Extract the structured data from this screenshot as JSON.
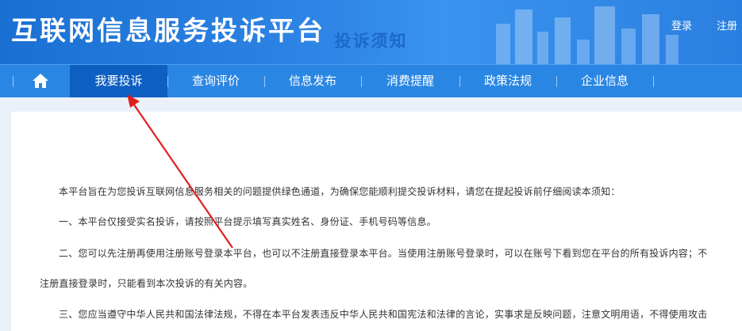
{
  "header": {
    "site_title": "互联网信息服务投诉平台",
    "login_label": "登录",
    "register_label": "注册"
  },
  "nav": {
    "home_icon": "home-icon",
    "items": [
      {
        "label": "我要投诉",
        "active": true
      },
      {
        "label": "查询评价",
        "active": false
      },
      {
        "label": "信息发布",
        "active": false
      },
      {
        "label": "消费提醒",
        "active": false
      },
      {
        "label": "政策法规",
        "active": false
      },
      {
        "label": "企业信息",
        "active": false
      }
    ]
  },
  "notice": {
    "title": "投诉须知",
    "paragraphs": [
      "本平台旨在为您投诉互联网信息服务相关的问题提供绿色通道，为确保您能顺利提交投诉材料，请您在提起投诉前仔细阅读本须知：",
      "一、本平台仅接受实名投诉，请按照平台提示填写真实姓名、身份证、手机号码等信息。",
      "二、您可以先注册再使用注册账号登录本平台，也可以不注册直接登录本平台。当使用注册账号登录时，可以在账号下看到您在平台的所有投诉内容；不",
      "注册直接登录时，只能看到本次投诉的有关内容。",
      "三、您应当遵守中华人民共和国法律法规，不得在本平台发表违反中华人民共和国宪法和法律的言论，实事求是反映问题，注意文明用语，不得使用攻击"
    ]
  },
  "colors": {
    "header_blue": "#2a7fe0",
    "nav_blue": "#2a86e3",
    "nav_active": "#0e5fc2",
    "title_blue": "#1c69c9",
    "annotation_red": "#e02020"
  },
  "annotation": {
    "type": "red-arrow",
    "points_to": "我要投诉"
  }
}
